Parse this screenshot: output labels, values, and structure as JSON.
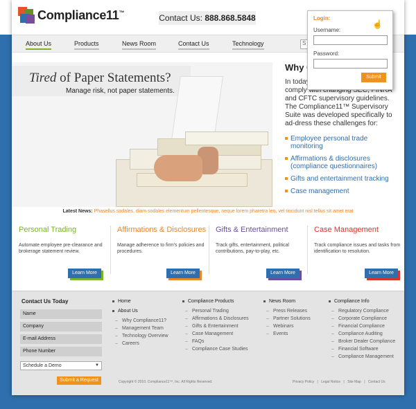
{
  "header": {
    "logo_text": "Compliance11",
    "logo_mark": "™",
    "contact_label": "Contact Us:",
    "contact_phone": "888.868.5848"
  },
  "nav": {
    "items": [
      "About Us",
      "Products",
      "News Room",
      "Contact Us",
      "Technology"
    ],
    "search_placeholder": "S"
  },
  "login": {
    "title": "Login:",
    "username_label": "Username:",
    "password_label": "Password:",
    "submit_label": "Submit"
  },
  "hero": {
    "title_italic": "Tired",
    "title_rest": " of Paper Statements?",
    "subtitle": "Manage risk, not paper statements."
  },
  "why": {
    "title": "Why C",
    "body": "In today firms are challenged to comply with changing SEC, FINRA and CFTC supervisory guidelines. The Compliance11™ Supervisory Suite was developed specifically to ad-dress these challenges for:",
    "bullets": [
      "Employee personal trade monitoring",
      "Affirmations & disclosures (compliance questionnaires)",
      "Gifts and entertainment tracking",
      "Case management"
    ]
  },
  "news": {
    "label": "Latest News:",
    "text": "Phasellus sodales, diam sodales elementum pellentesque, neque lorem pharetra leo, vel tincidunt nisl tellus sit amet erat"
  },
  "features": [
    {
      "title": "Personal Trading",
      "color": "#7ab32e",
      "desc": "Automate employee pre-clearance and brokerage statement review.",
      "button": "Learn More"
    },
    {
      "title": "Affirmations & Disclosures",
      "color": "#e8862a",
      "desc": "Manage adherence to firm's policies and procedures.",
      "button": "Learn More"
    },
    {
      "title": "Gifts & Entertainment",
      "color": "#6a4ea0",
      "desc": "Track gifts, entertainment, political contributions, pay-to-play, etc.",
      "button": "Learn More"
    },
    {
      "title": "Case Management",
      "color": "#d9342b",
      "desc": "Track compliance issues and tasks from identification to resolution.",
      "button": "Learn More"
    }
  ],
  "footer": {
    "contact_heading": "Contact Us Today",
    "fields": [
      "Name",
      "Company",
      "E-mail Address",
      "Phone Number"
    ],
    "select_value": "Schedule a Demo",
    "submit": "Submit a Request",
    "col1": {
      "home": "Home",
      "about": "About Us",
      "items": [
        "Why Compliance11?",
        "Management Team",
        "Technology Overview",
        "Careers"
      ]
    },
    "col2": {
      "heading": "Compliance Products",
      "items": [
        "Personal Trading",
        "Affirmations & Disclosures",
        "Gifts & Entertainment",
        "Case Management",
        "FAQs",
        "Compliance Case Studies"
      ]
    },
    "col3": {
      "heading": "News Room",
      "items": [
        "Press Releases",
        "Partner Solutions",
        "Webinars",
        "Events"
      ]
    },
    "col4": {
      "heading": "Compliance Info",
      "items": [
        "Regulatory Compliance",
        "Corporate Compliance",
        "Financial Compliance",
        "Compliance Auditing",
        "Broker Dealer Compliance",
        "Financial Software",
        "Compliance Management"
      ]
    },
    "copyright": "Copyright © 2010. Compliance11™, Inc. All Rights Reserved.",
    "links": [
      "Privacy Policy",
      "|",
      "Legal Notice",
      "|",
      "Site Map",
      "|",
      "Contact Us"
    ]
  }
}
